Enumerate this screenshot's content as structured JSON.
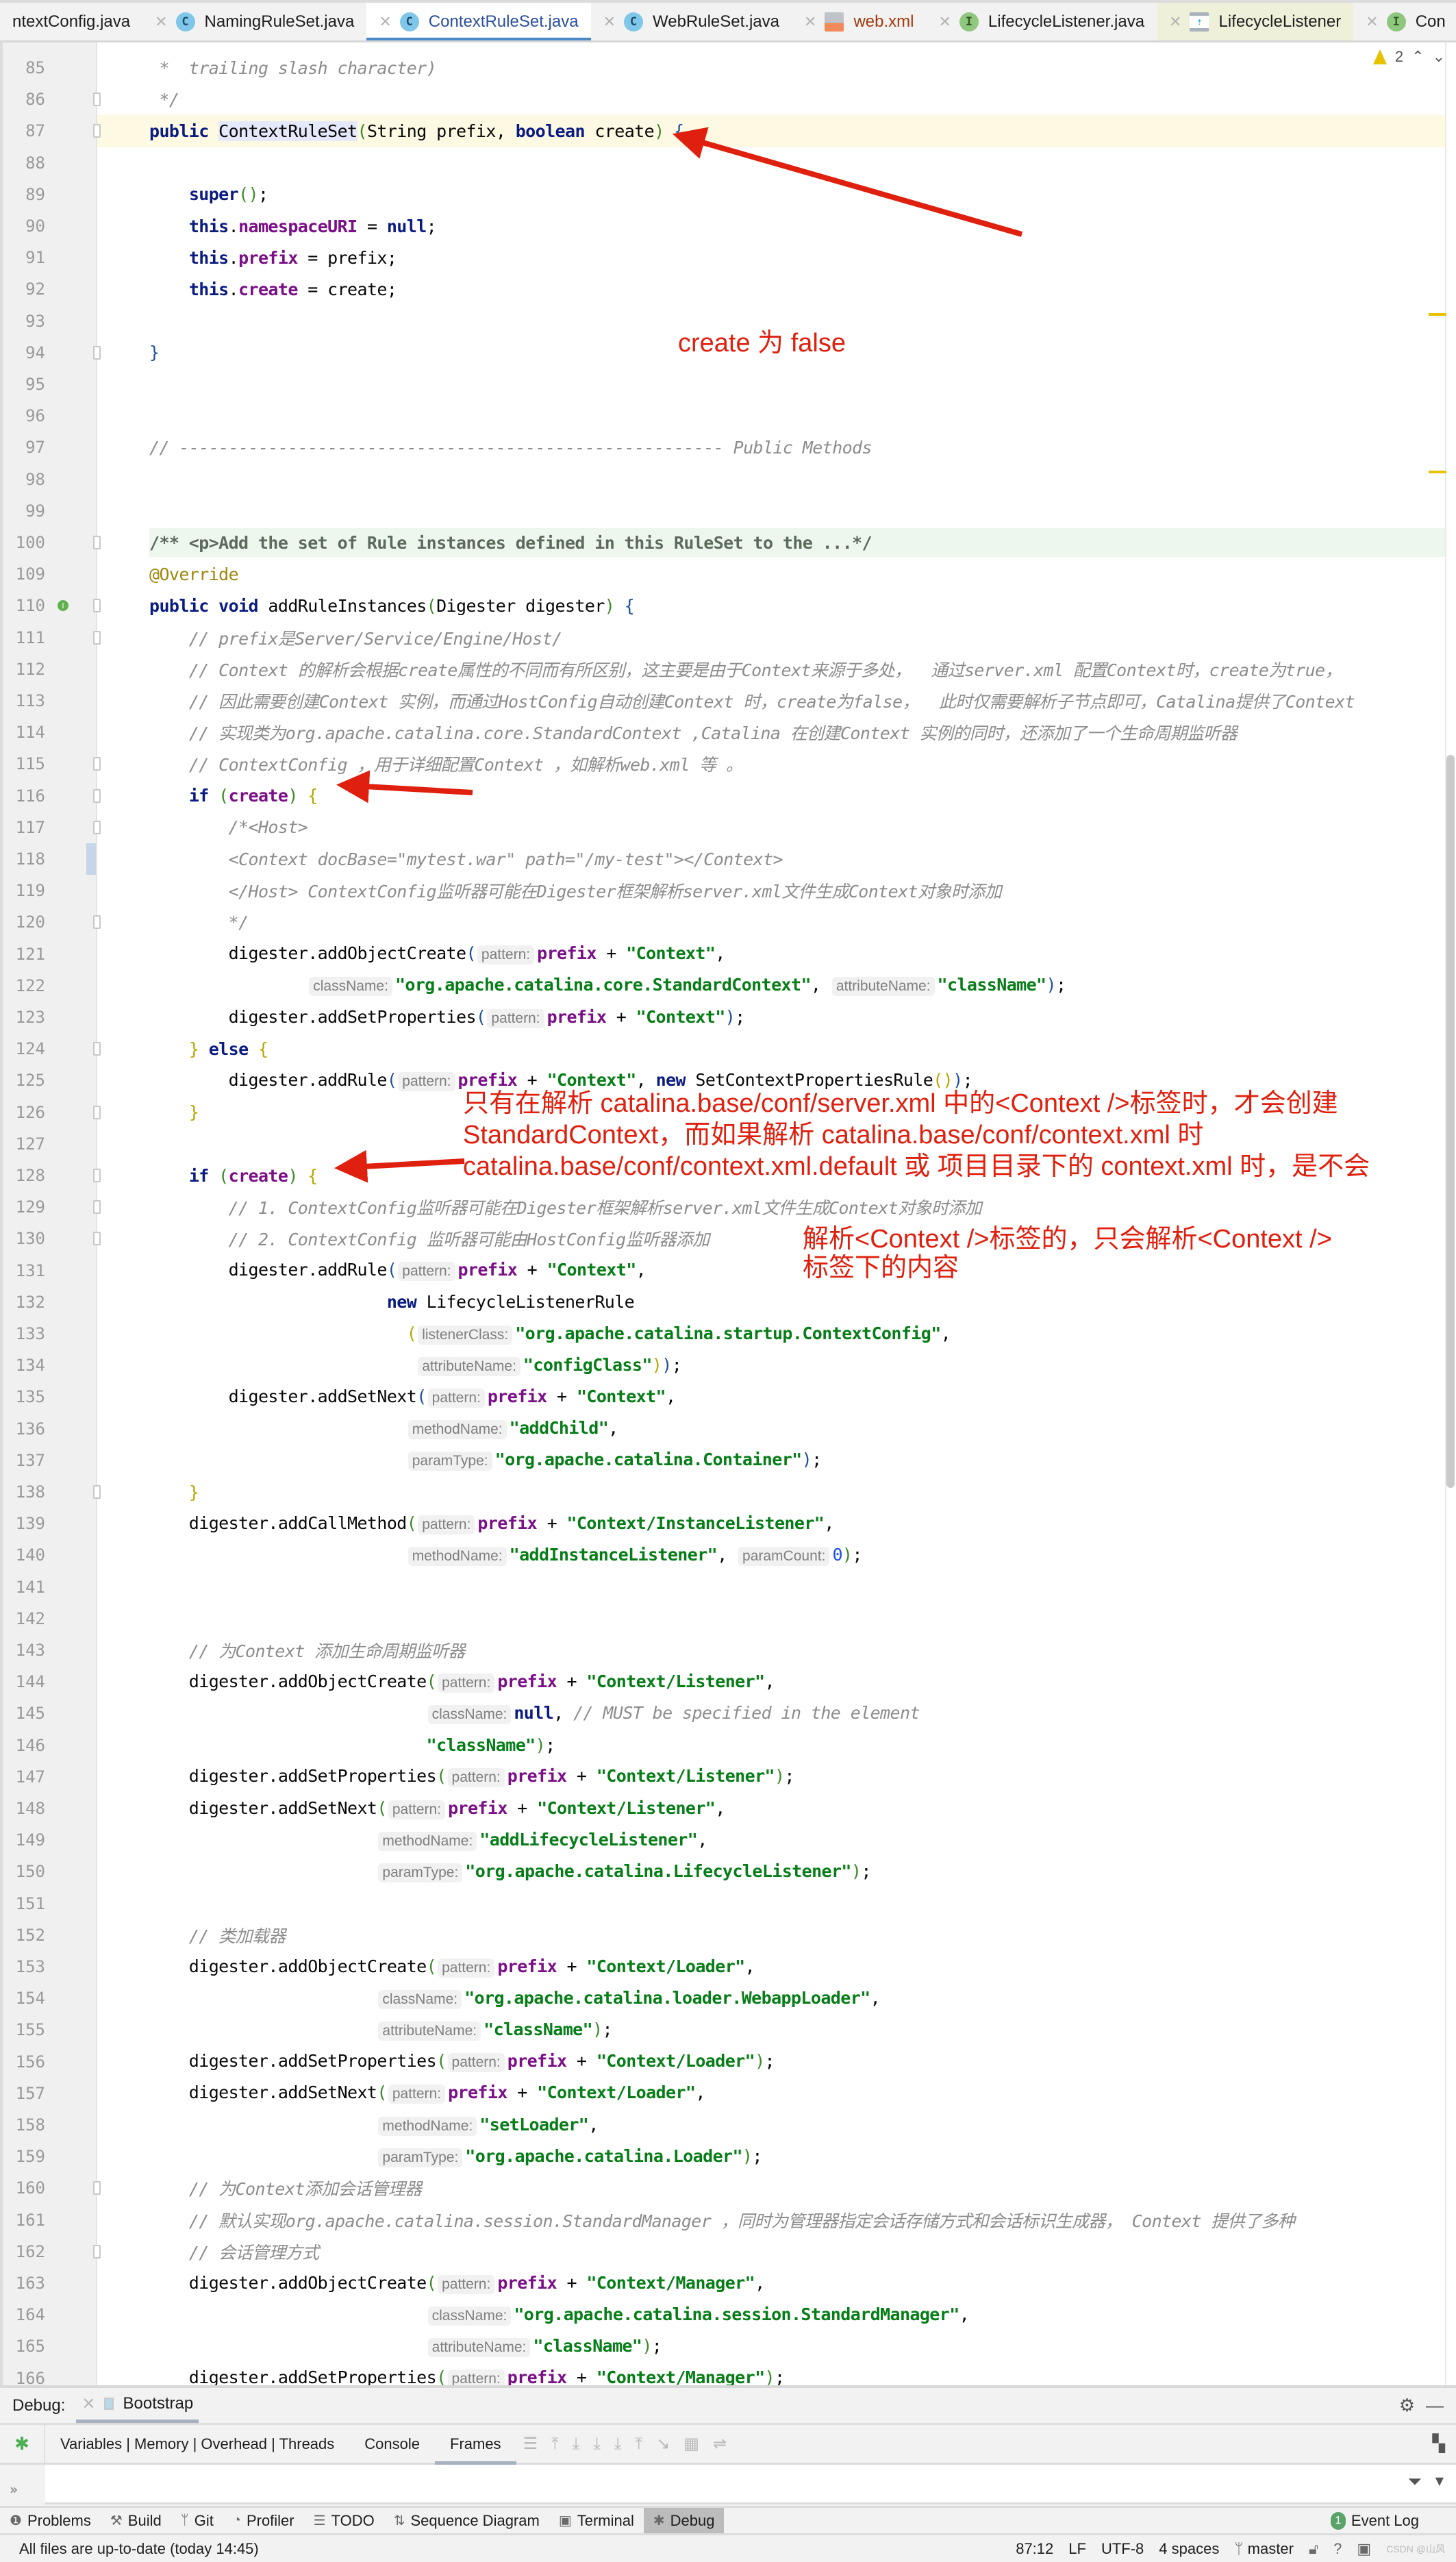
{
  "tabs": [
    {
      "label": "ntextConfig.java",
      "icon": "class-icon",
      "kind": "cls",
      "state": "normal",
      "show_icon": false
    },
    {
      "label": "NamingRuleSet.java",
      "icon": "class-icon",
      "kind": "cls",
      "state": "normal",
      "show_icon": true
    },
    {
      "label": "ContextRuleSet.java",
      "icon": "class-icon",
      "kind": "cls",
      "state": "active",
      "show_icon": true
    },
    {
      "label": "WebRuleSet.java",
      "icon": "class-icon",
      "kind": "cls",
      "state": "normal",
      "show_icon": true
    },
    {
      "label": "web.xml",
      "icon": "xml-file-icon",
      "kind": "xml",
      "state": "xml",
      "show_icon": true
    },
    {
      "label": "LifecycleListener.java",
      "icon": "interface-icon",
      "kind": "intf",
      "state": "normal",
      "show_icon": true
    },
    {
      "label": "LifecycleListener",
      "icon": "diagram-icon",
      "kind": "diag",
      "state": "preview",
      "show_icon": true
    },
    {
      "label": "Con",
      "icon": "interface-icon",
      "kind": "intf",
      "state": "normal",
      "show_icon": true
    }
  ],
  "tab_icon_letters": {
    "cls": "C",
    "intf": "I",
    "xml": "",
    "diag": "⇡"
  },
  "inspection": {
    "warnings": "2"
  },
  "code_lines": [
    {
      "n": "85",
      "html": "<span class='cmt'> *  trailing slash character)</span>"
    },
    {
      "n": "86",
      "html": "<span class='cmt'> */</span>",
      "fold": "end"
    },
    {
      "n": "87",
      "html": "<span class='kw'>public</span> <span class='hl-name'>ContextRuleSet</span><span class='brk-g'>(</span>String prefix, <span class='kw'>boolean</span> create<span class='brk-g'>)</span> <span class='brk-b'>{</span>",
      "current": true,
      "fold": "start"
    },
    {
      "n": "88",
      "html": ""
    },
    {
      "n": "89",
      "html": "    <span class='kw'>super</span><span class='brk-g'>()</span>;"
    },
    {
      "n": "90",
      "html": "    <span class='kw'>this</span>.<span class='fld'>namespaceURI</span> = <span class='kw'>null</span>;"
    },
    {
      "n": "91",
      "html": "    <span class='kw'>this</span>.<span class='fld'>prefix</span> = prefix;"
    },
    {
      "n": "92",
      "html": "    <span class='kw'>this</span>.<span class='fld'>create</span> = create;"
    },
    {
      "n": "93",
      "html": ""
    },
    {
      "n": "94",
      "html": "<span class='brk-b'>}</span>",
      "fold": "end"
    },
    {
      "n": "95",
      "html": ""
    },
    {
      "n": "96",
      "html": ""
    },
    {
      "n": "97",
      "html": "<span class='cmt'>// ------------------------------------------------------- Public Methods</span>"
    },
    {
      "n": "98",
      "html": ""
    },
    {
      "n": "99",
      "html": ""
    },
    {
      "n": "100",
      "html": "<span class='doccmt'>/** &lt;p&gt;Add the set of Rule instances defined in this RuleSet to the ...*/</span>",
      "doc": true,
      "fold": "plus"
    },
    {
      "n": "109",
      "html": "<span class='ann'>@Override</span>"
    },
    {
      "n": "110",
      "html": "<span class='kw'>public void</span> addRuleInstances<span class='brk-g'>(</span>Digester digester<span class='brk-g'>)</span> <span class='brk-b'>{</span>",
      "fold": "start",
      "override_marker": true
    },
    {
      "n": "111",
      "html": "    <span class='cmt'>// prefix是Server/Service/Engine/Host/</span>",
      "fold": "start"
    },
    {
      "n": "112",
      "html": "    <span class='cmt'>// Context 的解析会根据create属性的不同而有所区别，这主要是由于Context来源于多处，  通过server.xml 配置Context时，create为true，</span>"
    },
    {
      "n": "113",
      "html": "    <span class='cmt'>// 因此需要创建Context 实例，而通过HostConfig自动创建Context 时，create为false，  此时仅需要解析子节点即可，Catalina提供了Context</span>"
    },
    {
      "n": "114",
      "html": "    <span class='cmt'>// 实现类为org.apache.catalina.core.StandardContext ,Catalina 在创建Context 实例的同时，还添加了一个生命周期监听器</span>"
    },
    {
      "n": "115",
      "html": "    <span class='cmt'>// ContextConfig ，用于详细配置Context ，如解析web.xml 等 。</span>",
      "fold": "end"
    },
    {
      "n": "116",
      "html": "    <span class='kw'>if</span> <span class='brk-g'>(</span><span class='fld'>create</span><span class='brk-g'>)</span> <span class='brk-y'>{</span>",
      "fold": "start"
    },
    {
      "n": "117",
      "html": "        <span class='cmt'>/*&lt;Host&gt;</span>",
      "fold": "start"
    },
    {
      "n": "118",
      "html": "        <span class='cmt'>&lt;Context docBase=\"mytest.war\" path=\"/my-test\"&gt;&lt;/Context&gt;</span>",
      "changed": true
    },
    {
      "n": "119",
      "html": "        <span class='cmt'>&lt;/Host&gt; ContextConfig监听器可能在Digester框架解析server.xml文件生成Context对象时添加</span>"
    },
    {
      "n": "120",
      "html": "        <span class='cmt'>*/</span>",
      "fold": "end"
    },
    {
      "n": "121",
      "html": "        digester.addObjectCreate<span class='brk-b'>(</span><span class='hint'>pattern:</span><span class='fld'>prefix</span> + <span class='str'>\"Context\"</span>,"
    },
    {
      "n": "122",
      "html": "                <span class='hint'>className:</span><span class='str'>\"org.apache.catalina.core.StandardContext\"</span>, <span class='hint'>attributeName:</span><span class='str'>\"className\"</span><span class='brk-b'>)</span>;"
    },
    {
      "n": "123",
      "html": "        digester.addSetProperties<span class='brk-b'>(</span><span class='hint'>pattern:</span><span class='fld'>prefix</span> + <span class='str'>\"Context\"</span><span class='brk-b'>)</span>;"
    },
    {
      "n": "124",
      "html": "    <span class='brk-y'>}</span> <span class='kw'>else</span> <span class='brk-y'>{</span>",
      "fold": "mid"
    },
    {
      "n": "125",
      "html": "        digester.addRule<span class='brk-b'>(</span><span class='hint'>pattern:</span><span class='fld'>prefix</span> + <span class='str'>\"Context\"</span>, <span class='kw'>new</span> SetContextPropertiesRule<span class='brk-y'>()</span><span class='brk-b'>)</span>;"
    },
    {
      "n": "126",
      "html": "    <span class='brk-y'>}</span>",
      "fold": "end"
    },
    {
      "n": "127",
      "html": ""
    },
    {
      "n": "128",
      "html": "    <span class='kw'>if</span> <span class='brk-g'>(</span><span class='fld'>create</span><span class='brk-g'>)</span> <span class='brk-y'>{</span>",
      "fold": "start"
    },
    {
      "n": "129",
      "html": "        <span class='cmt'>// 1. ContextConfig监听器可能在Digester框架解析server.xml文件生成Context对象时添加</span>",
      "fold": "start"
    },
    {
      "n": "130",
      "html": "        <span class='cmt'>// 2. ContextConfig 监听器可能由HostConfig监听器添加</span>",
      "fold": "end"
    },
    {
      "n": "131",
      "html": "        digester.addRule<span class='brk-b'>(</span><span class='hint'>pattern:</span><span class='fld'>prefix</span> + <span class='str'>\"Context\"</span>,"
    },
    {
      "n": "132",
      "html": "                        <span class='kw'>new</span> LifecycleListenerRule"
    },
    {
      "n": "133",
      "html": "                          <span class='brk-y'>(</span><span class='hint'>listenerClass:</span><span class='str'>\"org.apache.catalina.startup.ContextConfig\"</span>,"
    },
    {
      "n": "134",
      "html": "                           <span class='hint'>attributeName:</span><span class='str'>\"configClass\"</span><span class='brk-y'>)</span><span class='brk-b'>)</span>;"
    },
    {
      "n": "135",
      "html": "        digester.addSetNext<span class='brk-b'>(</span><span class='hint'>pattern:</span><span class='fld'>prefix</span> + <span class='str'>\"Context\"</span>,"
    },
    {
      "n": "136",
      "html": "                          <span class='hint'>methodName:</span><span class='str'>\"addChild\"</span>,"
    },
    {
      "n": "137",
      "html": "                          <span class='hint'>paramType:</span><span class='str'>\"org.apache.catalina.Container\"</span><span class='brk-b'>)</span>;"
    },
    {
      "n": "138",
      "html": "    <span class='brk-y'>}</span>",
      "fold": "end"
    },
    {
      "n": "139",
      "html": "    digester.addCallMethod<span class='brk-g'>(</span><span class='hint'>pattern:</span><span class='fld'>prefix</span> + <span class='str'>\"Context/InstanceListener\"</span>,"
    },
    {
      "n": "140",
      "html": "                          <span class='hint'>methodName:</span><span class='str'>\"addInstanceListener\"</span>, <span class='hint'>paramCount:</span><span class='num'>0</span><span class='brk-g'>)</span>;"
    },
    {
      "n": "141",
      "html": ""
    },
    {
      "n": "142",
      "html": ""
    },
    {
      "n": "143",
      "html": "    <span class='cmt'>// 为Context 添加生命周期监听器</span>"
    },
    {
      "n": "144",
      "html": "    digester.addObjectCreate<span class='brk-g'>(</span><span class='hint'>pattern:</span><span class='fld'>prefix</span> + <span class='str'>\"Context/Listener\"</span>,"
    },
    {
      "n": "145",
      "html": "                            <span class='hint'>className:</span><span class='kw'>null</span>, <span class='cmt'>// MUST be specified in the element</span>"
    },
    {
      "n": "146",
      "html": "                            <span class='str'>\"className\"</span><span class='brk-g'>)</span>;"
    },
    {
      "n": "147",
      "html": "    digester.addSetProperties<span class='brk-g'>(</span><span class='hint'>pattern:</span><span class='fld'>prefix</span> + <span class='str'>\"Context/Listener\"</span><span class='brk-g'>)</span>;"
    },
    {
      "n": "148",
      "html": "    digester.addSetNext<span class='brk-g'>(</span><span class='hint'>pattern:</span><span class='fld'>prefix</span> + <span class='str'>\"Context/Listener\"</span>,"
    },
    {
      "n": "149",
      "html": "                       <span class='hint'>methodName:</span><span class='str'>\"addLifecycleListener\"</span>,"
    },
    {
      "n": "150",
      "html": "                       <span class='hint'>paramType:</span><span class='str'>\"org.apache.catalina.LifecycleListener\"</span><span class='brk-g'>)</span>;"
    },
    {
      "n": "151",
      "html": ""
    },
    {
      "n": "152",
      "html": "    <span class='cmt'>// 类加载器</span>"
    },
    {
      "n": "153",
      "html": "    digester.addObjectCreate<span class='brk-g'>(</span><span class='hint'>pattern:</span><span class='fld'>prefix</span> + <span class='str'>\"Context/Loader\"</span>,"
    },
    {
      "n": "154",
      "html": "                       <span class='hint'>className:</span><span class='str'>\"org.apache.catalina.loader.WebappLoader\"</span>,"
    },
    {
      "n": "155",
      "html": "                       <span class='hint'>attributeName:</span><span class='str'>\"className\"</span><span class='brk-g'>)</span>;"
    },
    {
      "n": "156",
      "html": "    digester.addSetProperties<span class='brk-g'>(</span><span class='hint'>pattern:</span><span class='fld'>prefix</span> + <span class='str'>\"Context/Loader\"</span><span class='brk-g'>)</span>;"
    },
    {
      "n": "157",
      "html": "    digester.addSetNext<span class='brk-g'>(</span><span class='hint'>pattern:</span><span class='fld'>prefix</span> + <span class='str'>\"Context/Loader\"</span>,"
    },
    {
      "n": "158",
      "html": "                       <span class='hint'>methodName:</span><span class='str'>\"setLoader\"</span>,"
    },
    {
      "n": "159",
      "html": "                       <span class='hint'>paramType:</span><span class='str'>\"org.apache.catalina.Loader\"</span><span class='brk-g'>)</span>;"
    },
    {
      "n": "160",
      "html": "    <span class='cmt'>// 为Context添加会话管理器</span>",
      "fold": "start"
    },
    {
      "n": "161",
      "html": "    <span class='cmt'>// 默认实现org.apache.catalina.session.StandardManager ，同时为管理器指定会话存储方式和会话标识生成器， Context 提供了多种</span>"
    },
    {
      "n": "162",
      "html": "    <span class='cmt'>// 会话管理方式</span>",
      "fold": "end"
    },
    {
      "n": "163",
      "html": "    digester.addObjectCreate<span class='brk-g'>(</span><span class='hint'>pattern:</span><span class='fld'>prefix</span> + <span class='str'>\"Context/Manager\"</span>,"
    },
    {
      "n": "164",
      "html": "                            <span class='hint'>className:</span><span class='str'>\"org.apache.catalina.session.StandardManager\"</span>,"
    },
    {
      "n": "165",
      "html": "                            <span class='hint'>attributeName:</span><span class='str'>\"className\"</span><span class='brk-g'>)</span>;"
    },
    {
      "n": "166",
      "html": "    digester.addSetProperties<span class='brk-g'>(</span><span class='hint'>pattern:</span><span class='fld'>prefix</span> + <span class='str'>\"Context/Manager\"</span><span class='brk-g'>)</span>;"
    }
  ],
  "annotations": {
    "create_false": "create 为 false",
    "server_xml_note": "只有在解析 catalina.base/conf/server.xml 中的<Context />标签时，才会创建\nStandardContext，而如果解析 catalina.base/conf/context.xml 时\ncatalina.base/conf/context.xml.default 或 项目目录下的 context.xml 时，是不会",
    "parse_note": "解析<Context />标签的，只会解析<Context />\n标签下的内容"
  },
  "debug": {
    "label": "Debug:",
    "session": "Bootstrap",
    "tabs": [
      {
        "label": "Variables | Memory | Overhead | Threads",
        "active": false
      },
      {
        "label": "Console",
        "active": false
      },
      {
        "label": "Frames",
        "active": true
      }
    ]
  },
  "tool_windows": [
    {
      "label": "Problems",
      "icon": "problems-icon",
      "glyph": "❶",
      "active": false
    },
    {
      "label": "Build",
      "icon": "build-hammer-icon",
      "glyph": "⚒",
      "active": false
    },
    {
      "label": "Git",
      "icon": "git-branch-icon",
      "glyph": "ᛘ",
      "active": false
    },
    {
      "label": "Profiler",
      "icon": "profiler-icon",
      "glyph": "◔",
      "active": false
    },
    {
      "label": "TODO",
      "icon": "todo-list-icon",
      "glyph": "☰",
      "active": false
    },
    {
      "label": "Sequence Diagram",
      "icon": "sequence-diagram-icon",
      "glyph": "⇅",
      "active": false
    },
    {
      "label": "Terminal",
      "icon": "terminal-icon",
      "glyph": "▣",
      "active": false
    },
    {
      "label": "Debug",
      "icon": "debug-bug-icon",
      "glyph": "✱",
      "active": true
    }
  ],
  "event_log": {
    "label": "Event Log",
    "count": "1"
  },
  "status": {
    "message": "All files are up-to-date (today 14:45)",
    "position": "87:12",
    "line_sep": "LF",
    "encoding": "UTF-8",
    "indent": "4 spaces",
    "branch": "master",
    "watermark": "CSDN @山风"
  },
  "colors": {
    "annotation_red": "#e0200e",
    "active_tab_underline": "#4a88c7"
  }
}
